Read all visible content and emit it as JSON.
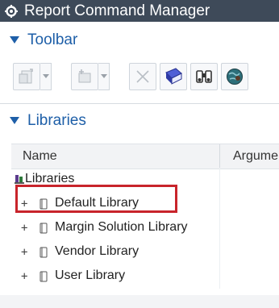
{
  "window": {
    "title": "Report Command Manager"
  },
  "sections": {
    "toolbar_label": "Toolbar",
    "libraries_label": "Libraries"
  },
  "toolbar": {
    "buttons": [
      {
        "name": "new-report-button",
        "enabled": false
      },
      {
        "name": "new-item-button",
        "enabled": false
      },
      {
        "name": "delete-button",
        "enabled": false
      },
      {
        "name": "library-button",
        "enabled": true
      },
      {
        "name": "find-button",
        "enabled": true
      },
      {
        "name": "web-button",
        "enabled": true
      }
    ]
  },
  "table": {
    "columns": [
      "Name",
      "Argumer"
    ],
    "root": "Libraries",
    "rows": [
      {
        "expander": "+",
        "label": "Default Library",
        "selected": true
      },
      {
        "expander": "+",
        "label": "Margin Solution Library",
        "selected": false
      },
      {
        "expander": "+",
        "label": "Vendor Library",
        "selected": false
      },
      {
        "expander": "+",
        "label": "User Library",
        "selected": false
      }
    ]
  },
  "colors": {
    "titlebar": "#3e4a59",
    "section_header_text": "#1e5fa8",
    "highlight_border": "#c8242b"
  }
}
